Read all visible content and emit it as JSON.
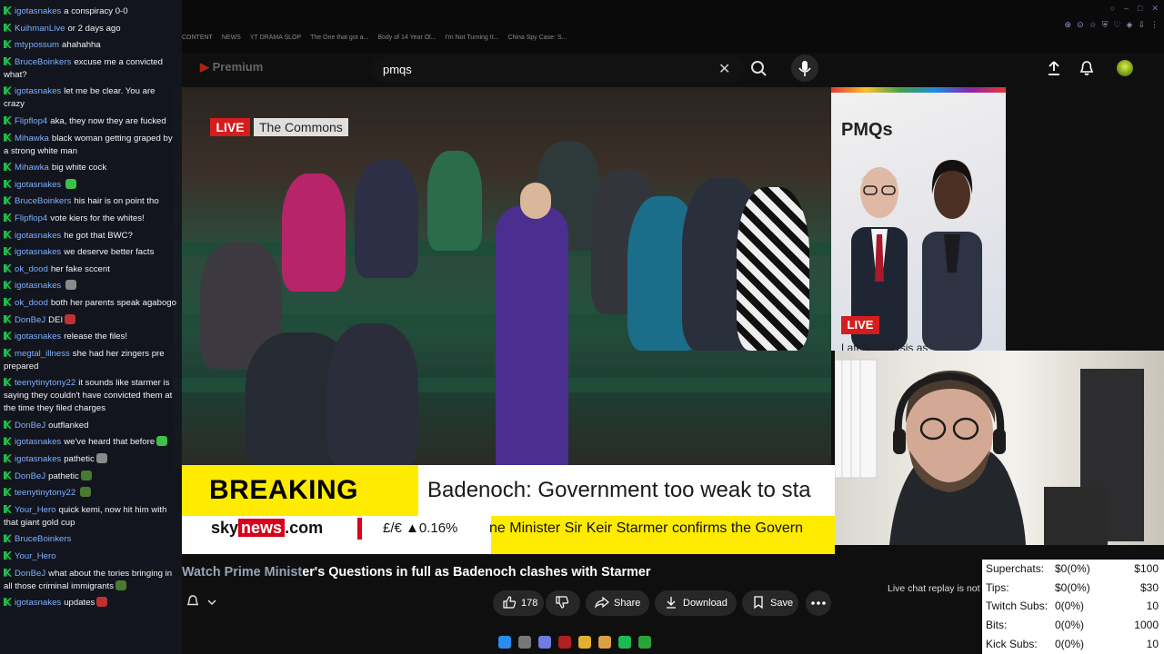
{
  "browser": {
    "bookmarks": [
      "CONTENT",
      "NEWS",
      "YT DRAMA SLOP",
      "The One that got a...",
      "Body of 14 Year Ol...",
      "I'm Not Turning It...",
      "China Spy Case: S..."
    ]
  },
  "youtube": {
    "logo_label": "Premium",
    "search_value": "pmqs"
  },
  "video": {
    "live_badge": "LIVE",
    "live_label": "The Commons",
    "breaking_label": "BREAKING NEWS",
    "breaking_headline": "Badenoch: Government too weak to sta",
    "sky_sky": "sky",
    "sky_news": "news",
    "sky_com": ".com",
    "fx_text": "£/€ ▲0.16%",
    "ticker_text": "ne Minister Sir Keir Starmer confirms the Govern",
    "title_faded": "Watch Prime Minist",
    "title_rest": "er's Questions in full as Badenoch clashes with Starmer",
    "like_count": "178",
    "share_label": "Share",
    "download_label": "Download",
    "save_label": "Save",
    "chat_replay_text": "Live chat replay is not"
  },
  "preview": {
    "title": "PMQs",
    "live_badge": "LIVE",
    "subtitle": "Latest analysis as"
  },
  "chat": {
    "messages": [
      {
        "user": "igotasnakes",
        "text": "a conspiracy 0-0"
      },
      {
        "user": "KuihmanLive",
        "text": "or 2 days ago"
      },
      {
        "user": "mtypossum",
        "text": "ahahahha"
      },
      {
        "user": "BruceBoinkers",
        "text": "excuse me a convicted what?"
      },
      {
        "user": "igotasnakes",
        "text": "let me be clear. You are crazy"
      },
      {
        "user": "Flipflop4",
        "text": "aka, they now they are fucked"
      },
      {
        "user": "Mihawka",
        "text": "black woman getting graped by a strong white man"
      },
      {
        "user": "Mihawka",
        "text": "big white cock"
      },
      {
        "user": "igotasnakes",
        "text": ""
      },
      {
        "user": "BruceBoinkers",
        "text": "his hair is on point tho"
      },
      {
        "user": "Flipflop4",
        "text": "vote kiers for the whites!"
      },
      {
        "user": "igotasnakes",
        "text": "he got that BWC?"
      },
      {
        "user": "igotasnakes",
        "text": "we deserve better facts"
      },
      {
        "user": "ok_dood",
        "text": "her fake sccent"
      },
      {
        "user": "igotasnakes",
        "text": ""
      },
      {
        "user": "ok_dood",
        "text": "both her parents speak agabogo"
      },
      {
        "user": "DonBeJ",
        "text": "DEI"
      },
      {
        "user": "igotasnakes",
        "text": "release the files!"
      },
      {
        "user": "megtal_illness",
        "text": "she had her zingers pre prepared"
      },
      {
        "user": "teenytinytony22",
        "text": "it sounds like starmer is saying they couldn't have convicted them at the time they filed charges"
      },
      {
        "user": "DonBeJ",
        "text": "outflanked"
      },
      {
        "user": "igotasnakes",
        "text": "we've heard that before"
      },
      {
        "user": "igotasnakes",
        "text": "pathetic"
      },
      {
        "user": "DonBeJ",
        "text": "pathetic"
      },
      {
        "user": "teenytinytony22",
        "text": ""
      },
      {
        "user": "Your_Hero",
        "text": "quick kemi, now hit him with that giant gold cup"
      },
      {
        "user": "BruceBoinkers",
        "text": ""
      },
      {
        "user": "Your_Hero",
        "text": ""
      },
      {
        "user": "DonBeJ",
        "text": "what about the tories bringing in all those criminal immigrants"
      },
      {
        "user": "igotasnakes",
        "text": "updates"
      }
    ]
  },
  "stats": {
    "rows": [
      {
        "label": "Superchats:",
        "value": "$0(0%)",
        "target": "$100"
      },
      {
        "label": "Tips:",
        "value": "$0(0%)",
        "target": "$30"
      },
      {
        "label": "Twitch Subs:",
        "value": "0(0%)",
        "target": "10"
      },
      {
        "label": "Bits:",
        "value": "0(0%)",
        "target": "1000"
      },
      {
        "label": "Kick Subs:",
        "value": "0(0%)",
        "target": "10"
      }
    ]
  },
  "colors": {
    "live_red": "#d41e1e",
    "breaking_yellow": "#ffeb00",
    "chat_user": "#7fb0ff",
    "badge_green": "#1dbb4a"
  }
}
